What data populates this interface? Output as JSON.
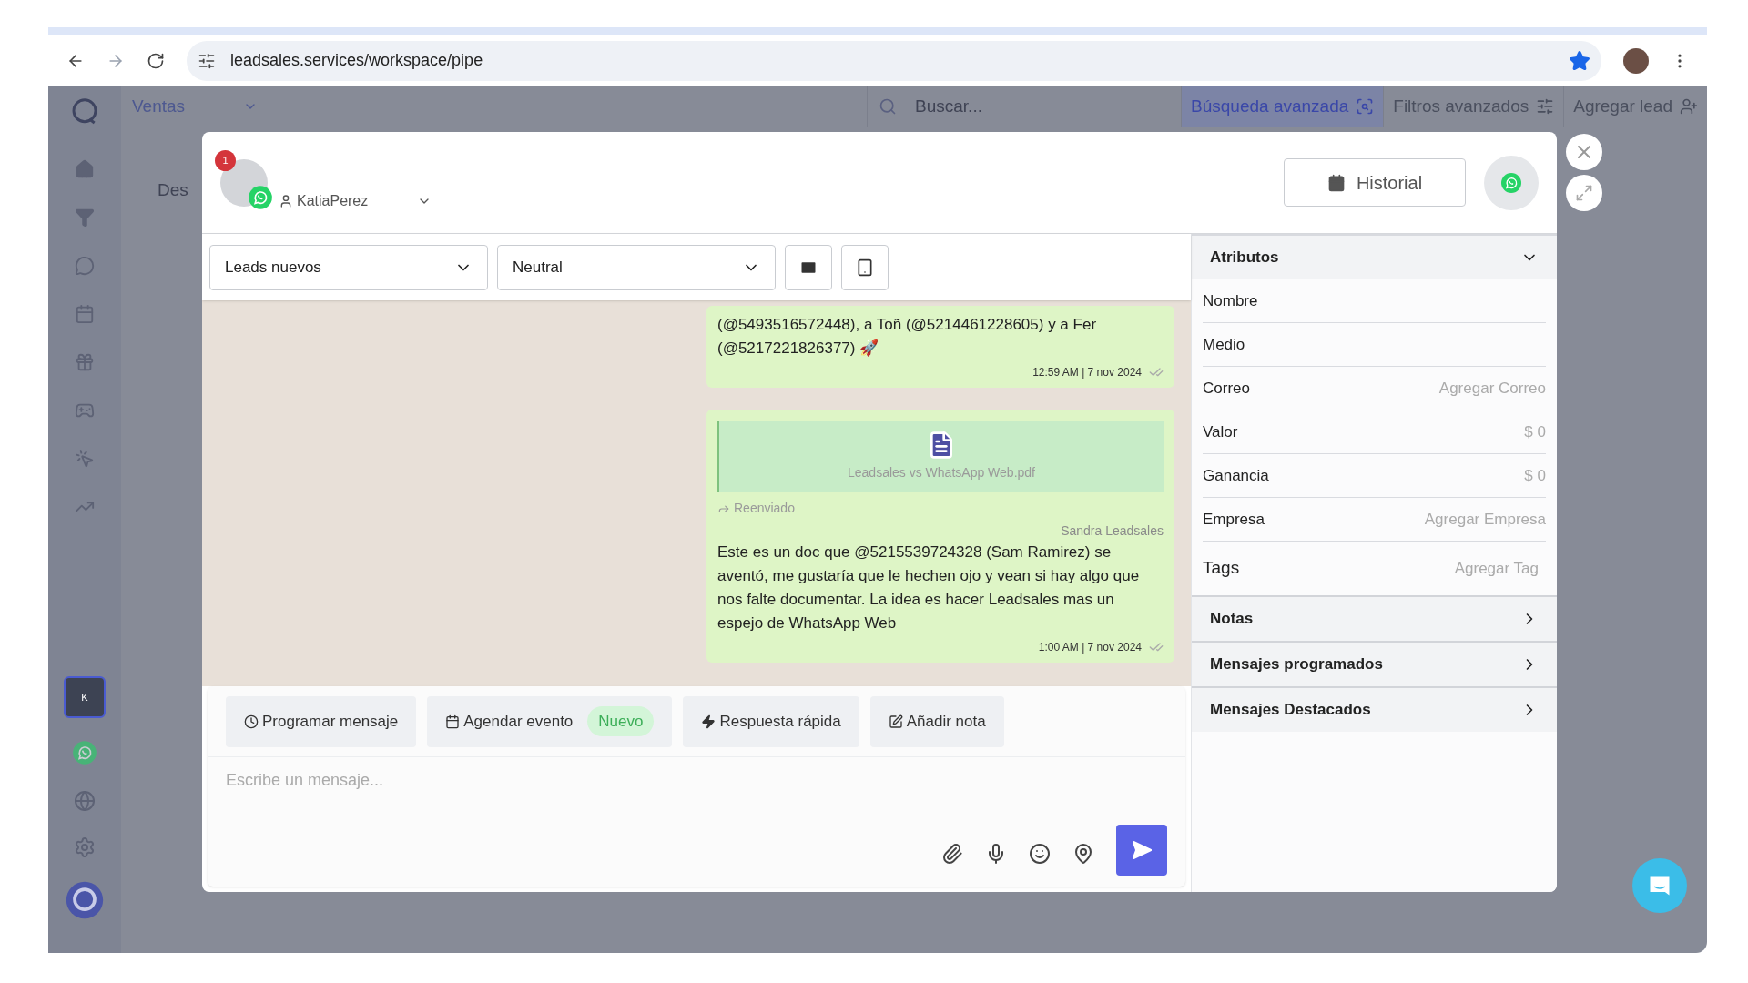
{
  "browser": {
    "url": "leadsales.services/workspace/pipe"
  },
  "app": {
    "workspace": "Ventas",
    "search_placeholder": "Buscar...",
    "header_buttons": [
      {
        "label": "Búsqueda avanzada",
        "kind": "search",
        "selected": true
      },
      {
        "label": "Filtros avanzados",
        "kind": "filter",
        "selected": false
      },
      {
        "label": "Agregar lead",
        "kind": "add",
        "selected": false
      }
    ],
    "avatar_initial": "K",
    "background_text": "Des"
  },
  "modal": {
    "unread_badge": "1",
    "contact": "KatiaPerez",
    "history_button": "Historial",
    "stage": "Leads nuevos",
    "sentiment": "Neutral",
    "messages": [
      {
        "kind": "text",
        "text": "(@5493516572448), a Toñ (@5214461228605) y a Fer (@5217221826377) 🚀",
        "meta": "12:59 AM | 7 nov 2024"
      },
      {
        "kind": "document",
        "file": "Leadsales vs WhatsApp Web.pdf",
        "forwarded": "Reenviado",
        "sender": "Sandra Leadsales",
        "text": "Este es un doc que @5215539724328 (Sam Ramirez) se aventó, me gustaría que le hechen ojo y vean si hay algo que nos falte documentar. La idea es hacer Leadsales mas un espejo de WhatsApp Web",
        "meta": "1:00 AM | 7 nov 2024"
      }
    ],
    "actions": [
      {
        "label": "Programar mensaje",
        "kind": "clock"
      },
      {
        "label": "Agendar evento",
        "kind": "calendar",
        "badge": "Nuevo"
      },
      {
        "label": "Respuesta rápida",
        "kind": "bolt"
      },
      {
        "label": "Añadir nota",
        "kind": "note"
      }
    ],
    "message_placeholder": "Escribe un mensaje...",
    "attributes": {
      "title": "Atributos",
      "expanded": true,
      "fields": [
        {
          "label": "Nombre",
          "kind": "text"
        },
        {
          "label": "Medio",
          "kind": "text"
        },
        {
          "label": "Correo",
          "kind": "text",
          "value": "Agregar Correo"
        },
        {
          "label": "Valor",
          "kind": "text",
          "value": "$ 0"
        },
        {
          "label": "Ganancia",
          "kind": "text",
          "value": "$ 0"
        },
        {
          "label": "Empresa",
          "kind": "text",
          "value": "Agregar Empresa"
        },
        {
          "label": "Tags",
          "kind": "tags",
          "value": "Agregar Tag"
        }
      ]
    },
    "sections": [
      {
        "title": "Notas",
        "expanded": false
      },
      {
        "title": "Mensajes programados",
        "expanded": false
      },
      {
        "title": "Mensajes Destacados",
        "expanded": false
      }
    ]
  }
}
